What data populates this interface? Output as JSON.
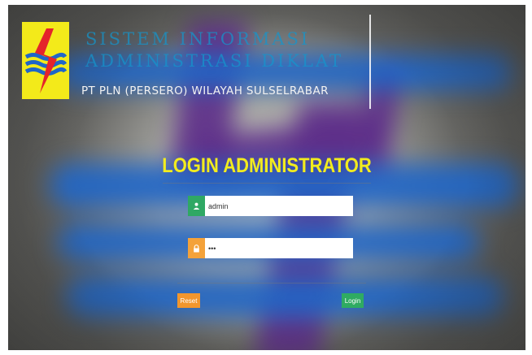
{
  "header": {
    "title_line1": "SISTEM INFORMASI",
    "title_line2": "ADMINISTRASI DIKLAT",
    "company": "PT PLN (PERSERO) WILAYAH SULSELRABAR",
    "logo_icon": "pln-lightning-logo"
  },
  "login": {
    "title": "LOGIN ADMINISTRATOR",
    "username": {
      "value": "admin",
      "icon": "user-icon"
    },
    "password": {
      "value": "•••",
      "icon": "lock-icon"
    },
    "reset_label": "Reset",
    "login_label": "Login"
  },
  "colors": {
    "title_yellow": "#f2ec1e",
    "user_addon": "#2fa864",
    "lock_addon": "#f4a23a",
    "reset_button": "#f2962d",
    "login_button": "#2fab62",
    "logo_yellow": "#f3ea1a",
    "logo_red": "#e4242b",
    "logo_blue": "#1f66c8"
  }
}
